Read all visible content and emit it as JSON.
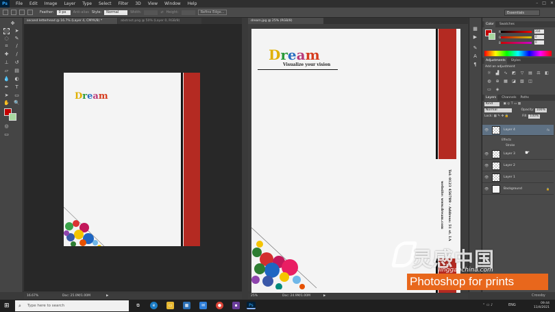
{
  "menubar": {
    "logo": "Ps",
    "items": [
      "File",
      "Edit",
      "Image",
      "Layer",
      "Type",
      "Select",
      "Filter",
      "3D",
      "View",
      "Window",
      "Help"
    ],
    "window_buttons": [
      "–",
      "□",
      "✕"
    ]
  },
  "optionsbar": {
    "feather_label": "Feather:",
    "feather_value": "0 px",
    "antialias_label": "Anti-alias",
    "style_label": "Style:",
    "style_value": "Normal",
    "width_label": "Width:",
    "height_label": "Height:",
    "refine_button": "Refine Edge...",
    "workspace": "Essentials"
  },
  "documents": {
    "tabs_left": [
      {
        "label": "second letterhead @ 16.7% (Layer 4, CMYK/8) *",
        "active": true
      },
      {
        "label": "abstract.png @ 50% (Layer 0, RGB/8)",
        "active": false
      }
    ],
    "tabs_right": [
      {
        "label": "dream.jpg @ 25% (RGB/8)",
        "active": true
      }
    ],
    "left_status": {
      "zoom": "16.67%",
      "doc": "Doc: 25.0M/1.00M"
    },
    "right_status": {
      "zoom": "25%",
      "doc": "Doc: 24.9M/1.00M"
    },
    "brand_word": "Dream",
    "tagline": "Visualize your vision",
    "contact_line1": "Tel: 0123 456789 - Address: 51 st. LA",
    "contact_line2": "website: www.dream.com"
  },
  "color_panel": {
    "tabs": [
      "Color",
      "Swatches"
    ],
    "r": "204",
    "g": "0",
    "b": "0",
    "fg_color": "#c40000",
    "bg_color": "#a8d8a0"
  },
  "adjustments_panel": {
    "tabs": [
      "Adjustments",
      "Styles"
    ],
    "title": "Add an adjustment"
  },
  "layers_panel": {
    "tabs": [
      "Layers",
      "Channels",
      "Paths"
    ],
    "kind": "Kind",
    "blend_mode": "Normal",
    "opacity_label": "Opacity:",
    "opacity_value": "100%",
    "lock_label": "Lock:",
    "fill_label": "Fill:",
    "fill_value": "100%",
    "layers": [
      {
        "name": "Layer 4",
        "selected": true,
        "fx": "fx"
      },
      {
        "name": "Layer 3",
        "selected": false
      },
      {
        "name": "Layer 2",
        "selected": false
      },
      {
        "name": "Layer 1",
        "selected": false
      },
      {
        "name": "Background",
        "selected": false
      }
    ],
    "effects_label": "Effects",
    "stroke_label": "Stroke"
  },
  "taskbar": {
    "search_placeholder": "Type here to search",
    "language": "ENG",
    "time": "09:44",
    "date": "11/4/2021"
  },
  "watermark": {
    "chinese": "灵感中国",
    "url": "lingganchina.com",
    "banner": "Photoshop for prints",
    "corner": "Crossby"
  }
}
